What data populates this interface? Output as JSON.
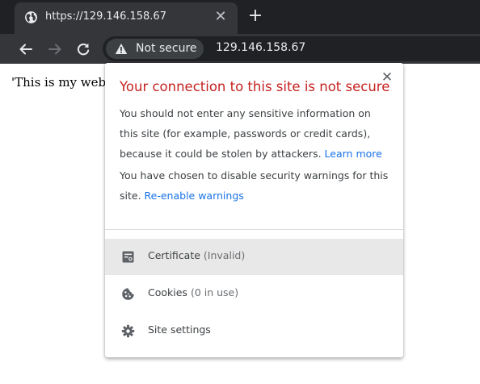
{
  "tab": {
    "title": "https://129.146.158.67",
    "close_glyph": "✕",
    "favicon": "globe-icon"
  },
  "newtab": {
    "glyph": "+"
  },
  "toolbar": {
    "security_chip": "Not secure",
    "url": "129.146.158.67"
  },
  "page": {
    "text": "'This is my web"
  },
  "bubble": {
    "close_glyph": "✕",
    "title": "Your connection to this site is not secure",
    "para1_text": "You should not enter any sensitive information on this site (for example, passwords or credit cards), because it could be stolen by attackers. ",
    "para1_link": "Learn more",
    "para2_text": "You have chosen to disable security warnings for this site. ",
    "para2_link": "Re-enable warnings",
    "items": [
      {
        "label": "Certificate",
        "sub": "(Invalid)",
        "icon": "certificate-icon"
      },
      {
        "label": "Cookies",
        "sub": "(0 in use)",
        "icon": "cookie-icon"
      },
      {
        "label": "Site settings",
        "sub": "",
        "icon": "gear-icon"
      }
    ]
  },
  "colors": {
    "title_red": "#c5221f",
    "link_blue": "#1a73e8",
    "tab_bg": "#35363a",
    "frame_bg": "#202124"
  }
}
